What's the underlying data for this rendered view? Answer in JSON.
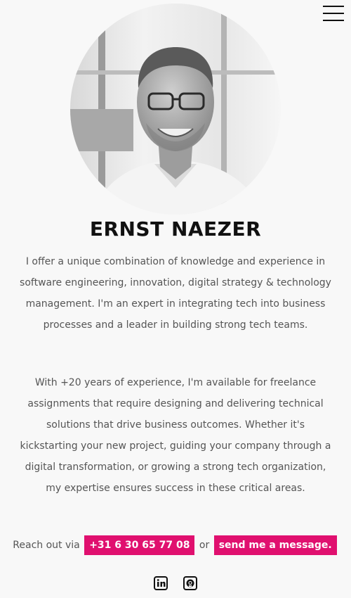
{
  "nav": {
    "menu_icon": "hamburger-menu-icon"
  },
  "profile": {
    "name": "ERNST NAEZER",
    "bio_1": "I offer a unique combination of knowledge and experience in software engineering, innovation, digital strategy & technology management. I'm an expert in integrating tech into business processes and a leader in building strong tech teams.",
    "bio_2": "With +20 years of experience, I'm available for freelance assignments that require designing and delivering technical solutions that drive business outcomes. Whether it's kickstarting your new project, guiding your company through a digital transformation, or growing a strong tech organization, my expertise ensures success in these critical areas."
  },
  "contact": {
    "prefix": "Reach out via",
    "phone": "+31 6 30 65 77 08",
    "connector": "or",
    "message": "send me a message."
  },
  "socials": {
    "linkedin_icon": "linkedin-icon",
    "github_icon": "github-icon"
  },
  "colors": {
    "accent": "#e0106f",
    "background": "#f8f8f8",
    "text": "#555555",
    "heading": "#111111"
  }
}
